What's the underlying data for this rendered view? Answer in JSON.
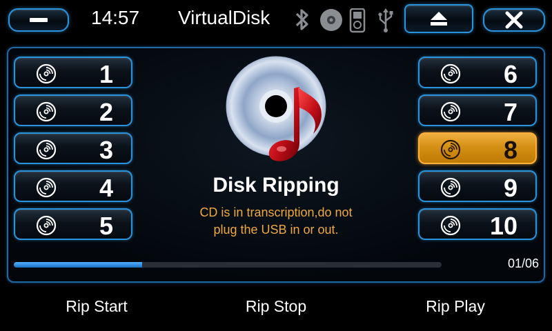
{
  "header": {
    "time": "14:57",
    "title": "VirtualDisk",
    "status_icons": [
      "bluetooth-icon",
      "disc-icon",
      "media-player-icon",
      "usb-icon"
    ],
    "buttons": [
      "minimize-icon",
      "eject-icon",
      "close-icon"
    ]
  },
  "tracks_left": [
    {
      "label": "1"
    },
    {
      "label": "2"
    },
    {
      "label": "3"
    },
    {
      "label": "4"
    },
    {
      "label": "5"
    }
  ],
  "tracks_right": [
    {
      "label": "6"
    },
    {
      "label": "7"
    },
    {
      "label": "8",
      "active": true
    },
    {
      "label": "9"
    },
    {
      "label": "10"
    }
  ],
  "ripping": {
    "title": "Disk Ripping",
    "message_line1": "CD is in transcription,do not",
    "message_line2": "plug the USB in or out."
  },
  "progress": {
    "fraction": 0.3,
    "counter": "01/06"
  },
  "bottom": {
    "rip_start": "Rip Start",
    "rip_stop": "Rip Stop",
    "rip_play": "Rip Play"
  },
  "colors": {
    "accent": "#2a93dd",
    "active": "#f0a830",
    "message": "#f0a840"
  }
}
